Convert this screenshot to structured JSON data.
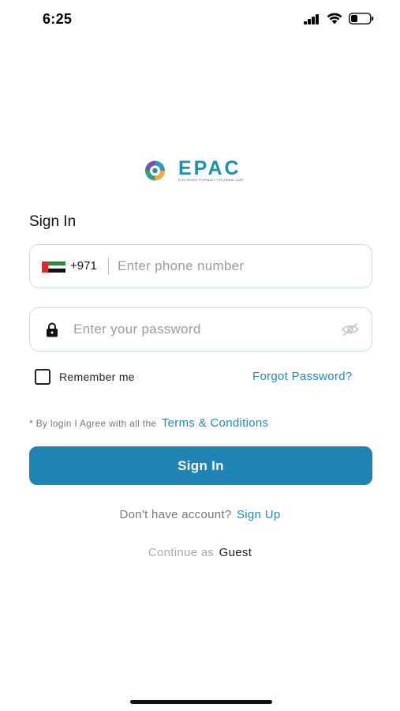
{
  "status_bar": {
    "time": "6:25"
  },
  "logo": {
    "name": "EPAC",
    "tagline": "ELECTRONIC PHARMACY FOR ANIMAL CARE"
  },
  "signin_title": "Sign In",
  "phone": {
    "country_flag": "uae-flag-icon",
    "dial_code": "+971",
    "value": "",
    "placeholder": "Enter phone number"
  },
  "password": {
    "value": "",
    "placeholder": "Enter your password",
    "lock_icon": "lock-icon",
    "visibility_icon": "eye-off-icon"
  },
  "remember": {
    "label": "Remember me",
    "checked": false
  },
  "forgot_password": "Forgot Password?",
  "terms": {
    "prefix": "* By login I Agree with all the",
    "link": "Terms & Conditions"
  },
  "signin_button": "Sign In",
  "signup": {
    "prefix": "Don't have account?",
    "link": "Sign Up"
  },
  "guest": {
    "prefix": "Continue as",
    "link": "Guest"
  },
  "colors": {
    "accent": "#1f84b3",
    "link": "#1f8bb0",
    "field_border": "#c6dde4",
    "logo_text": "#1e8fae"
  }
}
